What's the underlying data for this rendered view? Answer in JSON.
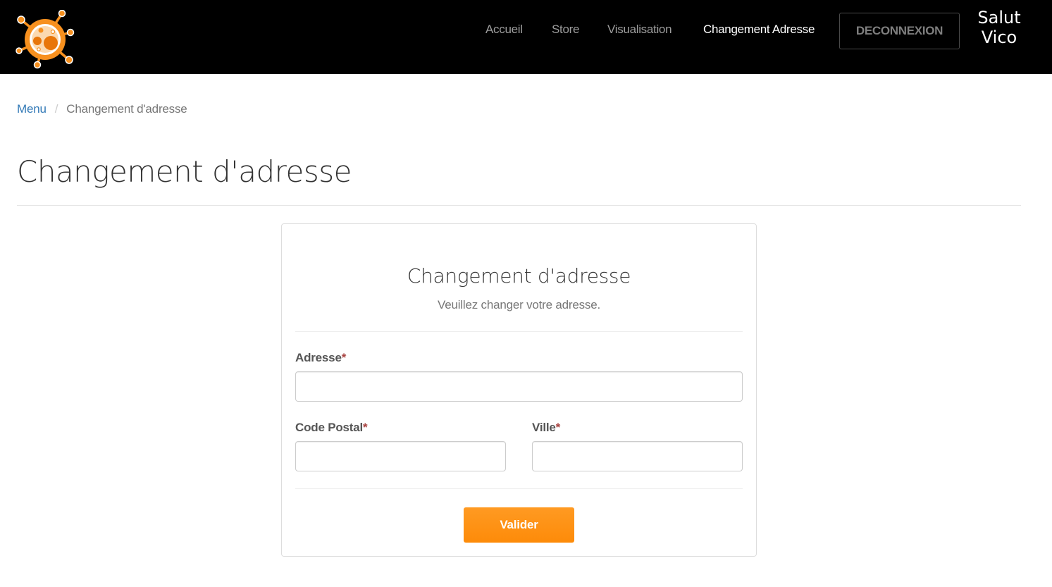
{
  "navbar": {
    "logo_icon": "virus-logo-icon",
    "links": [
      {
        "label": "Accueil",
        "active": false
      },
      {
        "label": "Store",
        "active": false
      },
      {
        "label": "Visualisation",
        "active": false
      },
      {
        "label": "Changement Adresse",
        "active": true
      }
    ],
    "logout_label": "DECONNEXION",
    "greeting_line1": "Salut",
    "greeting_line2": "Vico"
  },
  "breadcrumb": {
    "home_label": "Menu",
    "separator": "/",
    "current_label": "Changement d'adresse"
  },
  "page": {
    "title": "Changement d'adresse"
  },
  "form": {
    "title": "Changement d'adresse",
    "subtitle": "Veuillez changer votre adresse.",
    "required_marker": "*",
    "fields": {
      "adresse": {
        "label": "Adresse",
        "value": "",
        "placeholder": ""
      },
      "code_postal": {
        "label": "Code Postal",
        "value": "",
        "placeholder": ""
      },
      "ville": {
        "label": "Ville",
        "value": "",
        "placeholder": ""
      }
    },
    "submit_label": "Valider"
  },
  "colors": {
    "navbar_bg": "#000000",
    "nav_link": "#9d9d9d",
    "nav_link_active": "#ffffff",
    "link_blue": "#337ab7",
    "accent_orange": "#fd8b09",
    "required_red": "#a94442"
  }
}
